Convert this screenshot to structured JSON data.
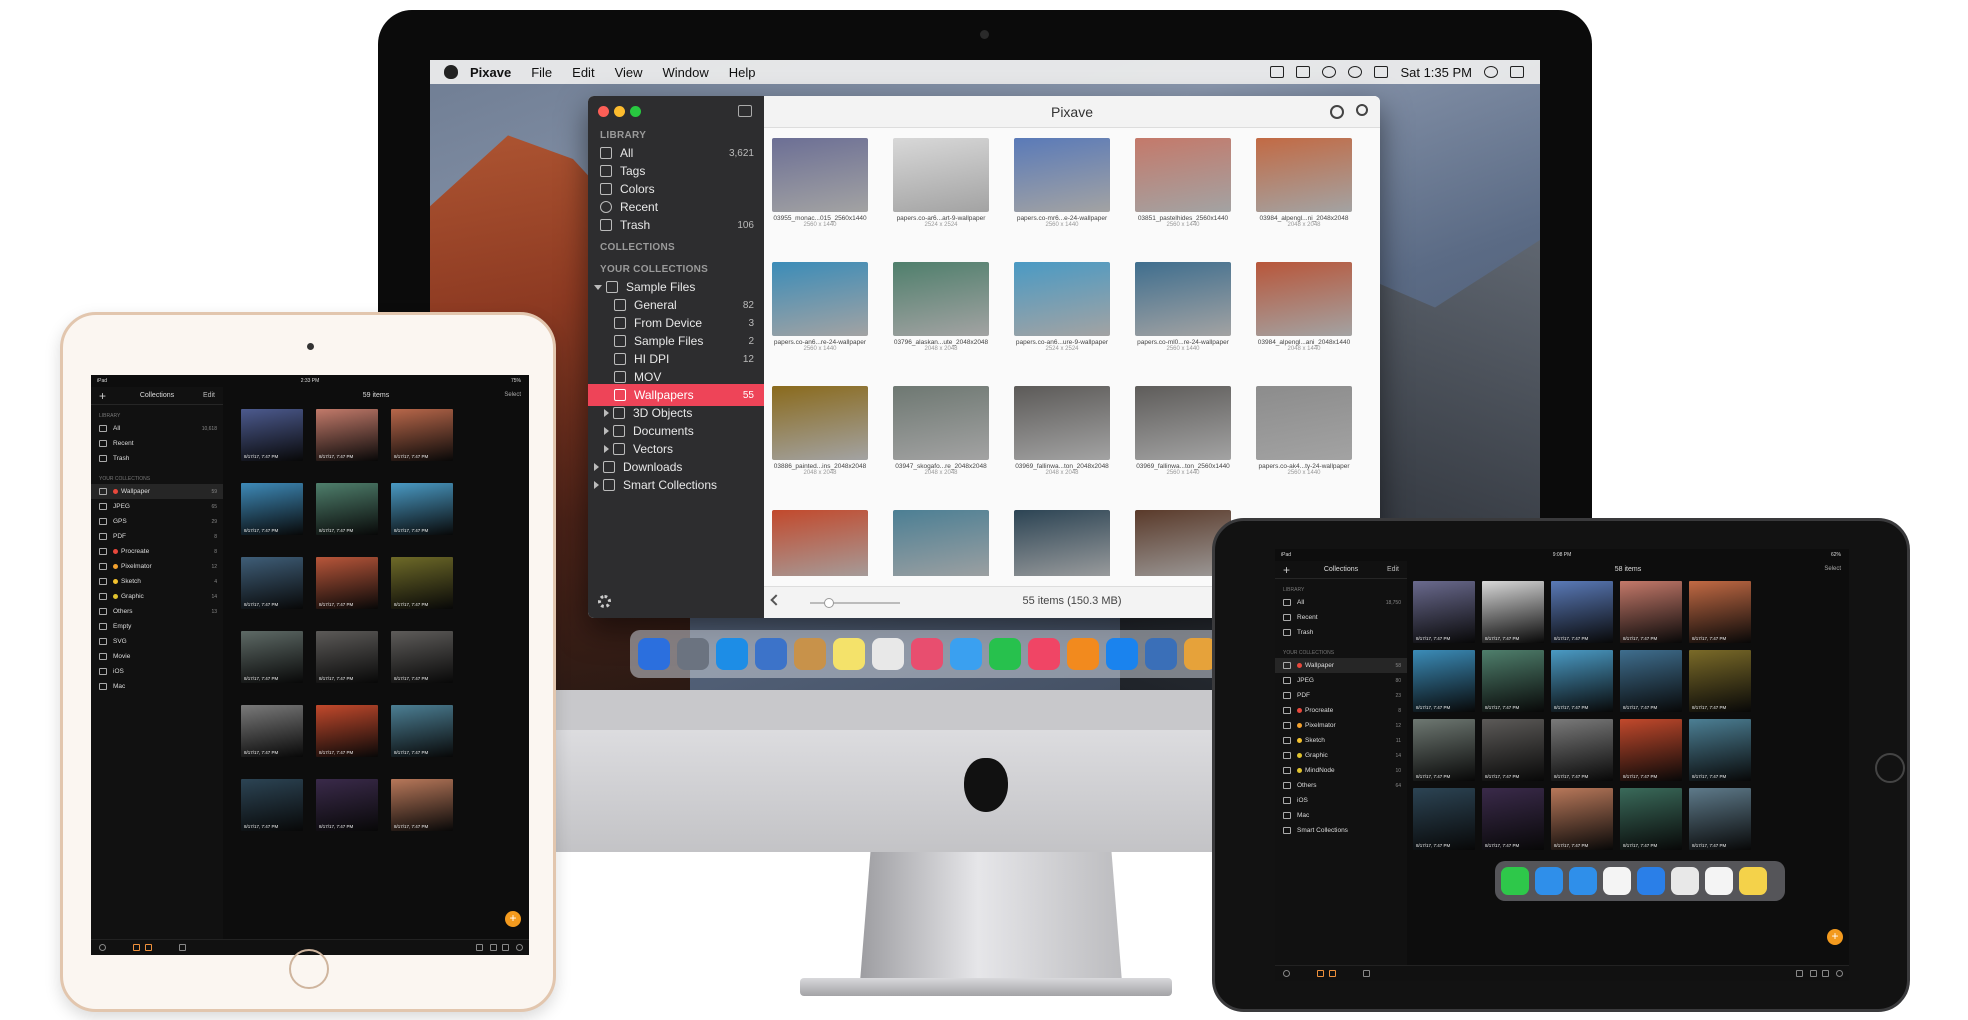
{
  "mac": {
    "menubar": {
      "app_name": "Pixave",
      "menus": [
        "File",
        "Edit",
        "View",
        "Window",
        "Help"
      ],
      "clock": "Sat 1:35 PM",
      "status_icons": [
        "camera-icon",
        "airplay-icon",
        "time-machine-icon",
        "wifi-icon",
        "keyboard-input-icon",
        "spotlight-icon",
        "notification-center-icon"
      ]
    },
    "window": {
      "title": "Pixave",
      "sidebar": {
        "library_header": "LIBRARY",
        "library": [
          {
            "label": "All",
            "count": "3,621",
            "icon": "all-icon"
          },
          {
            "label": "Tags",
            "count": "",
            "icon": "tag-icon"
          },
          {
            "label": "Colors",
            "count": "",
            "icon": "colors-icon"
          },
          {
            "label": "Recent",
            "count": "",
            "icon": "clock-icon"
          },
          {
            "label": "Trash",
            "count": "106",
            "icon": "trash-icon"
          }
        ],
        "collections_header": "COLLECTIONS",
        "your_collections_header": "YOUR COLLECTIONS",
        "collections": [
          {
            "label": "Sample Files",
            "count": "",
            "level": 0,
            "disclosure": "open"
          },
          {
            "label": "General",
            "count": "82",
            "level": 1,
            "disclosure": ""
          },
          {
            "label": "From Device",
            "count": "3",
            "level": 1,
            "disclosure": ""
          },
          {
            "label": "Sample Files",
            "count": "2",
            "level": 1,
            "disclosure": ""
          },
          {
            "label": "HI DPI",
            "count": "12",
            "level": 1,
            "disclosure": ""
          },
          {
            "label": "MOV",
            "count": "",
            "level": 1,
            "disclosure": ""
          },
          {
            "label": "Wallpapers",
            "count": "55",
            "level": 1,
            "disclosure": "",
            "selected": true
          },
          {
            "label": "3D Objects",
            "count": "",
            "level": 1,
            "disclosure": "closed"
          },
          {
            "label": "Documents",
            "count": "",
            "level": 1,
            "disclosure": "closed"
          },
          {
            "label": "Vectors",
            "count": "",
            "level": 1,
            "disclosure": "closed"
          },
          {
            "label": "Downloads",
            "count": "",
            "level": 0,
            "disclosure": "closed"
          },
          {
            "label": "Smart Collections",
            "count": "",
            "level": 0,
            "disclosure": "closed"
          }
        ]
      },
      "items": [
        {
          "name": "03955_monac...015_2560x1440",
          "dims": "2560 x 1440",
          "color": "#6c6f95"
        },
        {
          "name": "papers.co-ar6...art-9-wallpaper",
          "dims": "2524 x 2524",
          "color": "#d8d8d8"
        },
        {
          "name": "papers.co-mr6...e-24-wallpaper",
          "dims": "2560 x 1440",
          "color": "#5a7ab8"
        },
        {
          "name": "03851_pastelhides_2560x1440",
          "dims": "2560 x 1440",
          "color": "#c4796a"
        },
        {
          "name": "03984_alpengl...ni_2048x2048",
          "dims": "2048 x 2048",
          "color": "#c26a44"
        },
        {
          "name": "papers.co-an6...re-24-wallpaper",
          "dims": "2560 x 1440",
          "color": "#3b8cb8"
        },
        {
          "name": "03796_alaskan...ute_2048x2048",
          "dims": "2048 x 2048",
          "color": "#4f7f6c"
        },
        {
          "name": "papers.co-an6...ure-9-wallpaper",
          "dims": "2524 x 2524",
          "color": "#4a9ac4"
        },
        {
          "name": "papers.co-ml0...re-24-wallpaper",
          "dims": "2560 x 1440",
          "color": "#3f6e8e"
        },
        {
          "name": "03984_alpengl...ani_2048x1440",
          "dims": "2048 x 1440",
          "color": "#b8563a"
        },
        {
          "name": "03886_painted...ins_2048x2048",
          "dims": "2048 x 2048",
          "color": "#8a6a1c"
        },
        {
          "name": "03947_skogafo...re_2048x2048",
          "dims": "2048 x 2048",
          "color": "#6e7872"
        },
        {
          "name": "03969_fallinwa...ton_2048x2048",
          "dims": "2048 x 2048",
          "color": "#5c5a58"
        },
        {
          "name": "03969_fallinwa...ton_2560x1440",
          "dims": "2560 x 1440",
          "color": "#5e5c5a"
        },
        {
          "name": "papers.co-ak4...ty-24-wallpaper",
          "dims": "2560 x 1440",
          "color": "#8c8c8c"
        },
        {
          "name": "",
          "dims": "",
          "color": "#c2492c"
        },
        {
          "name": "",
          "dims": "",
          "color": "#4c7f94"
        },
        {
          "name": "",
          "dims": "",
          "color": "#2c4454"
        },
        {
          "name": "",
          "dims": "",
          "color": "#5a3a2a"
        }
      ],
      "status": "55 items (150.3 MB)"
    },
    "dock": [
      "#2b6fde",
      "#6b7380",
      "#1d8de6",
      "#3c73c9",
      "#c8924a",
      "#f4e26a",
      "#e8e8e8",
      "#e84e6f",
      "#3aa0f0",
      "#27c14d",
      "#f04565",
      "#f28a1e",
      "#1a83ee",
      "#3a6fb8",
      "#e6a23a"
    ]
  },
  "ipad_left": {
    "status_carrier": "iPad",
    "status_time": "2:33 PM",
    "status_battery": "75%",
    "side_header": "Collections",
    "edit": "Edit",
    "main_title": "59 items",
    "select": "Select",
    "library_header": "LIBRARY",
    "library": [
      {
        "label": "All",
        "count": "10,618"
      },
      {
        "label": "Recent",
        "count": ""
      },
      {
        "label": "Trash",
        "count": ""
      }
    ],
    "your_collections_header": "YOUR COLLECTIONS",
    "collections": [
      {
        "label": "Wallpaper",
        "count": "59",
        "dot": "#e8483c",
        "selected": true
      },
      {
        "label": "JPEG",
        "count": "65",
        "dot": ""
      },
      {
        "label": "GPS",
        "count": "29",
        "dot": ""
      },
      {
        "label": "PDF",
        "count": "8",
        "dot": ""
      },
      {
        "label": "Procreate",
        "count": "8",
        "dot": "#e8483c"
      },
      {
        "label": "Pixelmator",
        "count": "12",
        "dot": "#f3a12e"
      },
      {
        "label": "Sketch",
        "count": "4",
        "dot": "#f3c12e"
      },
      {
        "label": "Graphic",
        "count": "14",
        "dot": "#e0c22e"
      },
      {
        "label": "Others",
        "count": "13",
        "dot": ""
      },
      {
        "label": "Empty",
        "count": "",
        "dot": ""
      },
      {
        "label": "SVG",
        "count": "",
        "dot": ""
      },
      {
        "label": "Movie",
        "count": "",
        "dot": ""
      },
      {
        "label": "iOS",
        "count": "",
        "dot": ""
      },
      {
        "label": "Mac",
        "count": "",
        "dot": ""
      }
    ],
    "thumb_date": "8/17/17, 7:47 PM",
    "thumbs": [
      "#4c5a8e",
      "#c27a6a",
      "#b8674a",
      "#3e8ab8",
      "#4f7f6c",
      "#4a9ac4",
      "#3f5e78",
      "#b8563a",
      "#6e6a28",
      "#5e6a66",
      "#5c5a58",
      "#5e5c5a",
      "#7a7a7a",
      "#c2492c",
      "#4c7f94",
      "#2c4454",
      "#3a2a4a",
      "#b8785a"
    ]
  },
  "ipad_right": {
    "status_carrier": "iPad",
    "status_time": "9:08 PM",
    "status_battery": "62%",
    "side_header": "Collections",
    "edit": "Edit",
    "main_title": "58 items",
    "select": "Select",
    "library_header": "LIBRARY",
    "library": [
      {
        "label": "All",
        "count": "18,750"
      },
      {
        "label": "Recent",
        "count": ""
      },
      {
        "label": "Trash",
        "count": ""
      }
    ],
    "your_collections_header": "YOUR COLLECTIONS",
    "collections": [
      {
        "label": "Wallpaper",
        "count": "58",
        "dot": "#e8483c",
        "selected": true
      },
      {
        "label": "JPEG",
        "count": "80",
        "dot": ""
      },
      {
        "label": "PDF",
        "count": "23",
        "dot": ""
      },
      {
        "label": "Procreate",
        "count": "8",
        "dot": "#e8483c"
      },
      {
        "label": "Pixelmator",
        "count": "12",
        "dot": "#f3a12e"
      },
      {
        "label": "Sketch",
        "count": "11",
        "dot": "#f3c12e"
      },
      {
        "label": "Graphic",
        "count": "14",
        "dot": "#e0c22e"
      },
      {
        "label": "MindNode",
        "count": "10",
        "dot": "#e0c22e"
      },
      {
        "label": "Others",
        "count": "64",
        "dot": ""
      },
      {
        "label": "iOS",
        "count": "",
        "dot": ""
      },
      {
        "label": "Mac",
        "count": "",
        "dot": ""
      },
      {
        "label": "Smart Collections",
        "count": "",
        "dot": ""
      }
    ],
    "thumb_date": "8/17/17, 7:47 PM",
    "thumbs": [
      "#6a6a8e",
      "#d8d8d8",
      "#5a7ab8",
      "#c4796a",
      "#c26a44",
      "#3b8cb8",
      "#4f7f6c",
      "#4a9ac4",
      "#3f6e8e",
      "#7a6a28",
      "#6e7872",
      "#5c5a58",
      "#7a7a7a",
      "#c2492c",
      "#4c7f94",
      "#2c4454",
      "#3a2a4a",
      "#b8785a",
      "#3a6a5a",
      "#5e7a8a"
    ],
    "dock": [
      "#2ec84a",
      "#2f8fea",
      "#2f8fea",
      "#f4f4f4",
      "#2a7fe8",
      "#e8e8e8",
      "#f4f4f4",
      "#f4d24a"
    ]
  }
}
